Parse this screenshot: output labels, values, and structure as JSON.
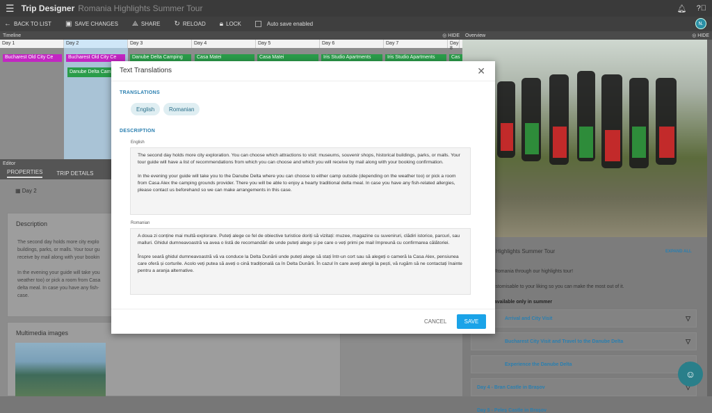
{
  "app": {
    "name": "Trip Designer",
    "trip_name": "Romania Highlights Summer Tour"
  },
  "toolbar": {
    "back": "BACK TO LIST",
    "save_changes": "SAVE CHANGES",
    "share": "SHARE",
    "reload": "RELOAD",
    "lock": "LOCK",
    "autosave": "Auto save enabled",
    "avatar": "N."
  },
  "timeline": {
    "title": "Timeline",
    "hide": "HIDE",
    "days": [
      "Day 1",
      "Day 2",
      "Day 3",
      "Day 4",
      "Day 5",
      "Day 6",
      "Day 7",
      "Day 8"
    ],
    "events": [
      "Bucharest Old City Ce",
      "Bucharest Old City Ce",
      "Danube Delta Camping",
      "Casa Matei",
      "Casa Matei",
      "Iris Studio Apartments",
      "Iris Studio Apartments",
      "Cas",
      "Danube Delta Cam"
    ]
  },
  "editor": {
    "title": "Editor",
    "tabs": [
      "PROPERTIES",
      "TRIP DETAILS"
    ],
    "day_label": "Day 2",
    "description_title": "Description",
    "description_lines": [
      "The second day holds more city explo",
      "buildings, parks, or malls. Your tour gu",
      "receive by mail along with your bookin",
      "",
      "In the evening your guide will take you",
      "weather too) or pick a room from Casa",
      "delta meal. In case you have any fish-",
      "case."
    ],
    "multimedia_title": "Multimedia images"
  },
  "overview": {
    "title": "Overview",
    "hide": "HIDE",
    "heading": "Highlights Summer Tour",
    "expand_all": "EXPAND ALL",
    "intro1": "e Romania through our highlights tour!",
    "intro2": "customisable to your liking so you can make the most out of it.",
    "intro3": "s available only in summer",
    "items": [
      "Arrival and City Visit",
      "Bucharest City Visit and Travel to the Danube Delta",
      "Experience the Danube Delta",
      "Day 4 - Bran Castle in Brașov",
      "Day 5 - Peleș Castle in Brașov"
    ]
  },
  "modal": {
    "title": "Text Translations",
    "translations_label": "TRANSLATIONS",
    "chips": [
      "English",
      "Romanian"
    ],
    "description_label": "DESCRIPTION",
    "english_label": "English",
    "english_p1": "The second day holds more city exploration. You can choose which attractions to visit: museums, souvenir shops, historical buildings, parks, or malls. Your tour guide will have a list of recommendations from which you can choose and which you will receive by mail along with your booking confirmation.",
    "english_p2": "In the evening your guide will take you to the Danube Delta where you can choose to either camp outside (depending on the weather too) or pick a room from Casa Alex the camping grounds provider. There you will be able to enjoy a hearty traditional delta meal. In case you have any fish-related allergies, please contact us beforehand so we can make arrangements in this case.",
    "romanian_label": "Romanian",
    "romanian_p1": "A doua zi conține mai multă explorare. Puteți alege ce fel de obiective turistice doriți să vizitați: muzee, magazine cu suveniruri, clădiri istorice, parcuri, sau malluri. Ghidul dumneavoastră va avea o listă de recomandări de unde puteți alege și pe care o veți primi pe mail împreună cu confirmarea călătoriei.",
    "romanian_p2": "Înspre seară ghidul dumneavoastră vă va conduce la Delta Dunării unde puteți alege să stați într-un cort sau să alegeți o cameră la Casa Alex, pensiunea care oferă și corturile. Acolo veți putea să aveți o cină tradițională ca în Delta Dunării. În cazul în care aveți alergii la pești, vă rugăm să ne contactați înainte pentru a aranja alternative.",
    "cancel": "CANCEL",
    "save": "SAVE"
  },
  "colors": {
    "accent": "#1aa3e8",
    "magenta": "#c326c3",
    "green": "#2a9c4a",
    "topbar": "#3a3a3a"
  },
  "icons": [
    "menu-icon",
    "bell-icon",
    "help-icon",
    "back-arrow-icon",
    "save-icon",
    "share-icon",
    "reload-icon",
    "lock-icon",
    "eye-off-icon",
    "close-icon",
    "chevron-down-icon",
    "chat-icon"
  ]
}
